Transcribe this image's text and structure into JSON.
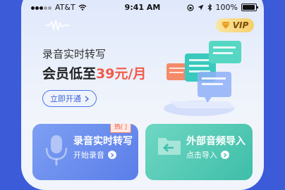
{
  "status_bar": {
    "carrier": "AT&T",
    "time": "9:41 AM",
    "battery": "100%"
  },
  "vip_badge": {
    "label": "VIP"
  },
  "hero": {
    "title": "录音实时转写",
    "price_prefix": "会员低至",
    "price_value": "39元/月",
    "open_button": "立即开通"
  },
  "cards": [
    {
      "title": "录音实时转写",
      "subtitle": "开始录音",
      "tag": "热门"
    },
    {
      "title": "外部音频导入",
      "subtitle": "点击导入"
    }
  ],
  "colors": {
    "accent": "#3c64df",
    "price": "#f25a4a",
    "record_card": "#6f90ef",
    "import_card": "#52cab4"
  }
}
